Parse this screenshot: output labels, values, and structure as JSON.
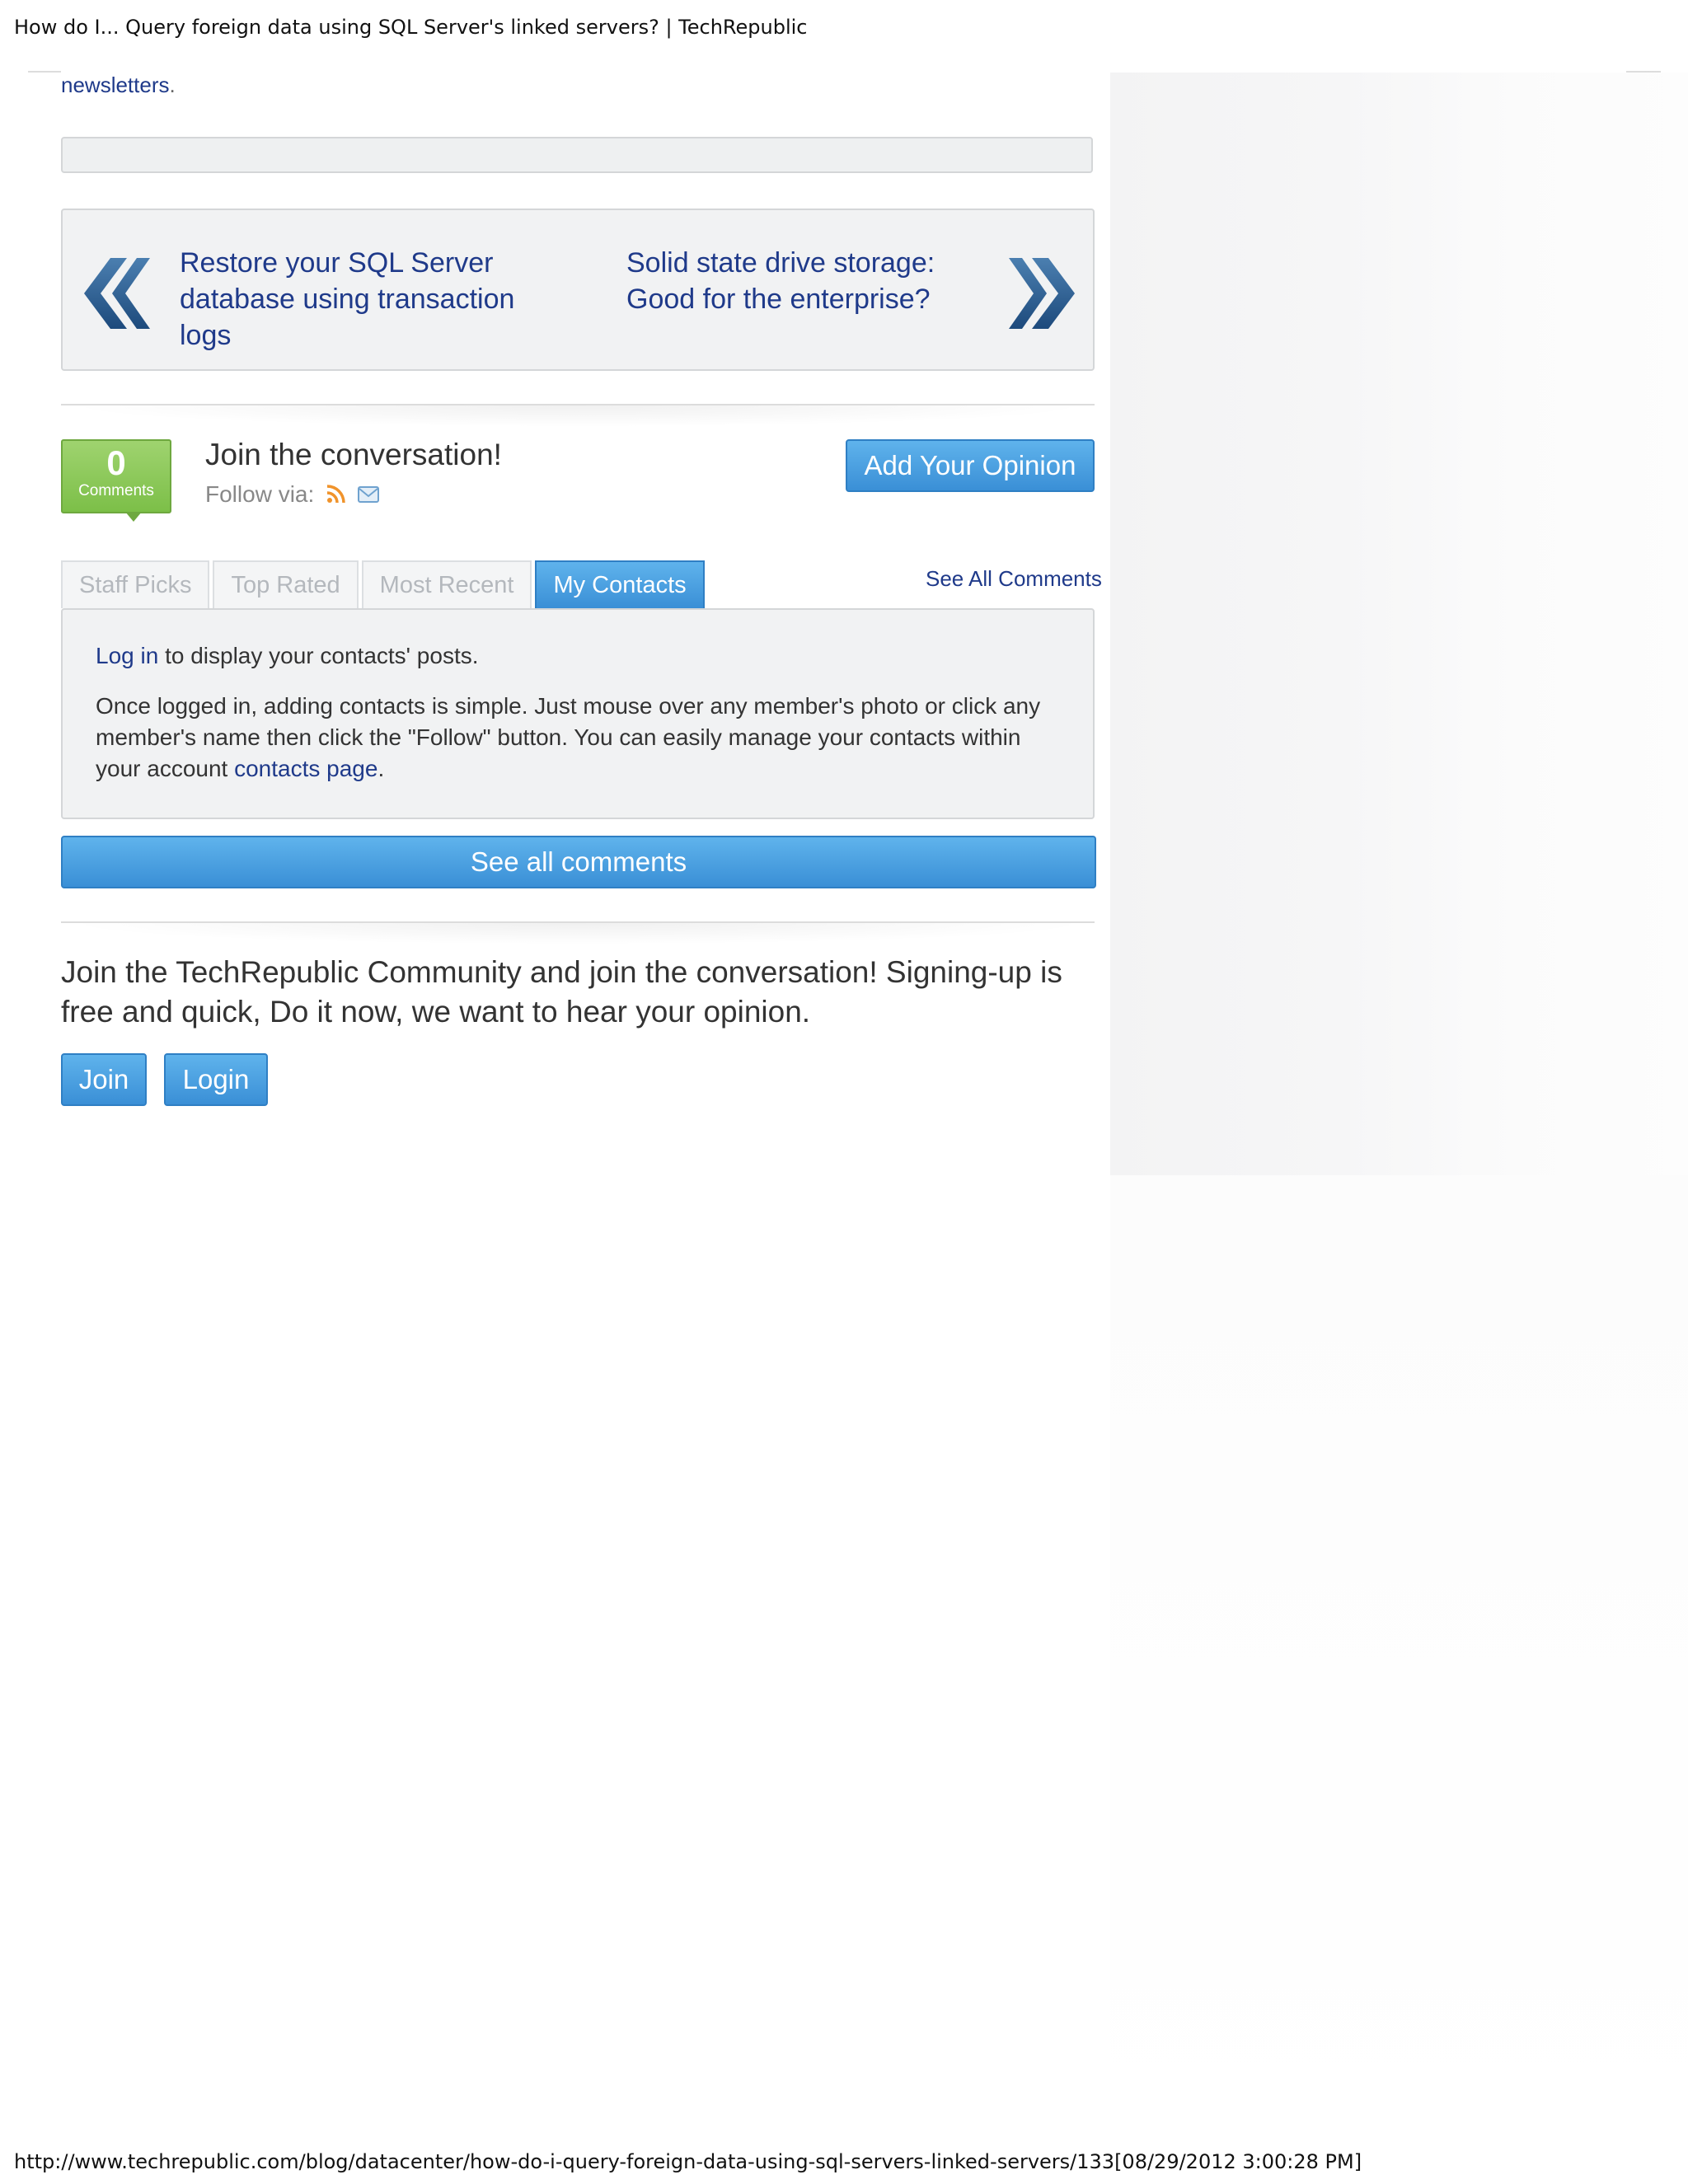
{
  "header": {
    "title": "How do I... Query foreign data using SQL Server's linked servers? | TechRepublic"
  },
  "newsletters": {
    "link": "newsletters",
    "period": "."
  },
  "post_nav": {
    "prev_label": "Restore your SQL Server database using transaction logs",
    "next_label": "Solid state drive storage: Good for the enterprise?",
    "prev_icon": "double-chevron-left-icon",
    "next_icon": "double-chevron-right-icon"
  },
  "comments": {
    "count": "0",
    "count_label": "Comments",
    "title": "Join the conversation!",
    "follow_label": "Follow via:",
    "follow_icons": [
      "rss-icon",
      "email-icon"
    ],
    "add_opinion_label": "Add Your Opinion",
    "see_all_link": "See All Comments",
    "tabs": [
      {
        "label": "Staff Picks",
        "active": false
      },
      {
        "label": "Top Rated",
        "active": false
      },
      {
        "label": "Most Recent",
        "active": false
      },
      {
        "label": "My Contacts",
        "active": true
      }
    ],
    "contacts_panel": {
      "login_link": "Log in",
      "login_suffix": " to display your contacts' posts.",
      "para_text": "Once logged in, adding contacts is simple. Just mouse over any member's photo or click any member's name then click the \"Follow\" button. You can easily manage your contacts within your account ",
      "contacts_link": "contacts page",
      "para_end": "."
    },
    "see_all_button": "See all comments"
  },
  "community": {
    "text": "Join the TechRepublic Community and join the conversation! Signing-up is free and quick, Do it now, we want to hear your opinion.",
    "join_label": "Join",
    "login_label": "Login"
  },
  "colors": {
    "link": "#1f3a8a",
    "button_blue": "#3a8fd6",
    "badge_green": "#7cbf48",
    "rss_orange": "#f0932b"
  },
  "footer": {
    "url": "http://www.techrepublic.com/blog/datacenter/how-do-i-query-foreign-data-using-sql-servers-linked-servers/133[08/29/2012 3:00:28 PM]"
  }
}
